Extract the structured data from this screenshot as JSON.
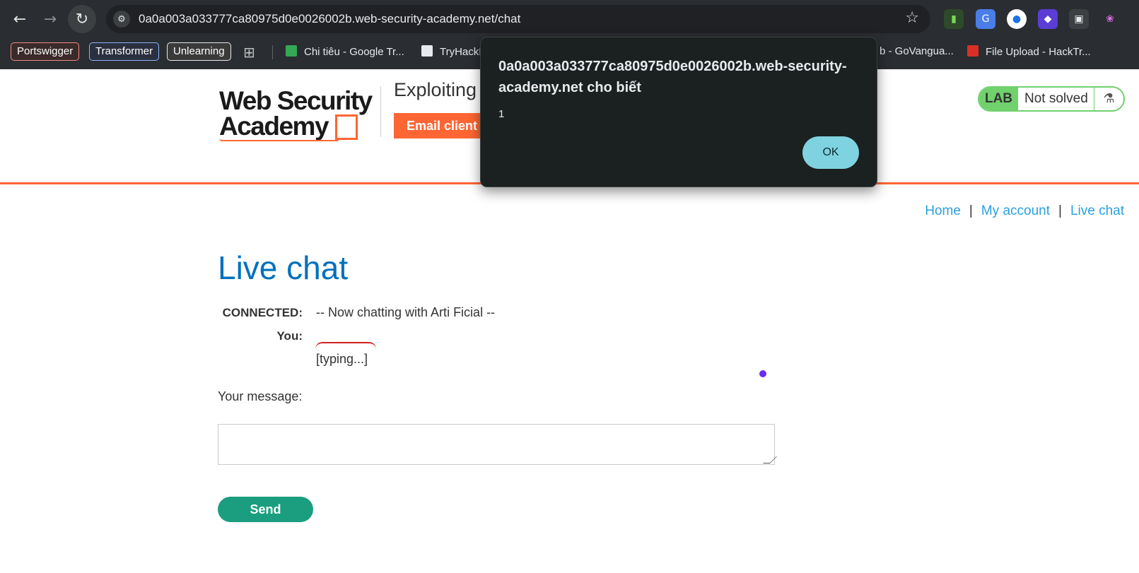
{
  "browser": {
    "url": "0a0a003a033777ca80975d0e0026002b.web-security-academy.net/chat",
    "bookmarks": {
      "tags": [
        "Portswigger",
        "Transformer",
        "Unlearning"
      ],
      "links": [
        {
          "label": "Chi tiêu - Google Tr...",
          "color": "#34a853"
        },
        {
          "label": "TryHackM",
          "color": "#e8eaed"
        },
        {
          "label": "b - GoVangua...",
          "color": "#e8eaed"
        },
        {
          "label": "File Upload - HackTr...",
          "color": "#d93025"
        }
      ]
    }
  },
  "lab": {
    "logo_line1": "Web Security",
    "logo_line2": "Academy",
    "title": "Exploiting",
    "email_button": "Email client",
    "status_badge": "LAB",
    "status_text": "Not solved",
    "accent": "#ff6633"
  },
  "nav": {
    "home": "Home",
    "separator": "|",
    "account": "My account",
    "chat": "Live chat"
  },
  "page_title": "Live chat",
  "chat": {
    "connected_label": "CONNECTED:",
    "connected_text": "-- Now chatting with Arti Ficial --",
    "you_label": "You:",
    "typing_text": "[typing...]",
    "message_label": "Your message:",
    "message_value": "",
    "send_button": "Send"
  },
  "dialog": {
    "title": "0a0a003a033777ca80975d0e0026002b.web-security-academy.net cho biết",
    "message": "1",
    "ok_button": "OK"
  }
}
